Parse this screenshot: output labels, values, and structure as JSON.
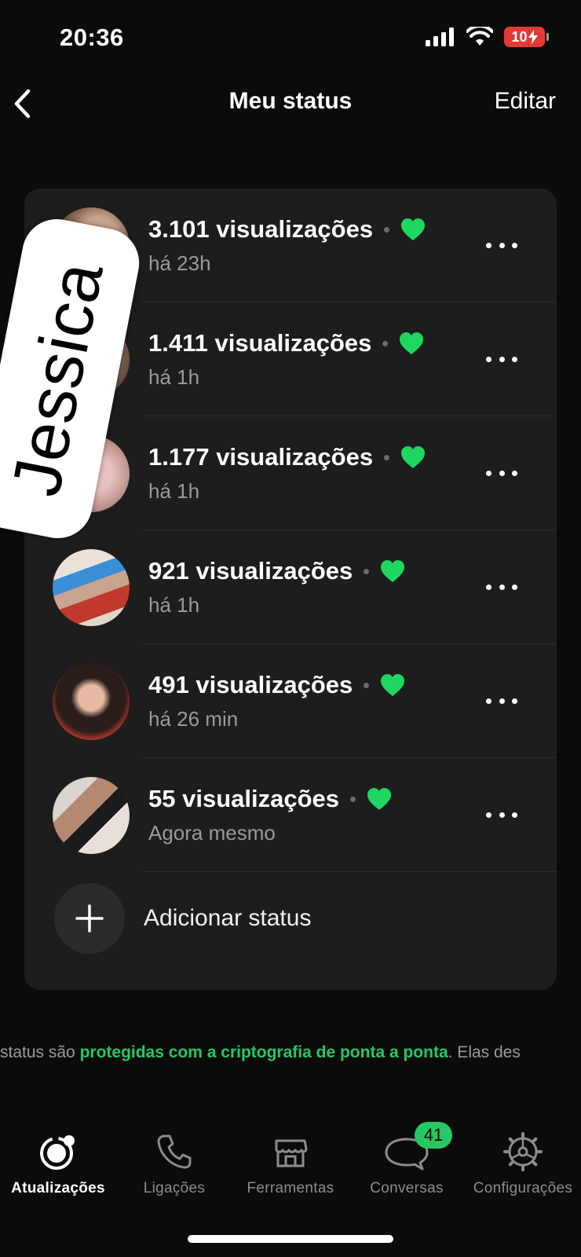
{
  "status_bar": {
    "time": "20:36",
    "battery": "10"
  },
  "nav": {
    "title": "Meu status",
    "edit_label": "Editar"
  },
  "sticker": {
    "text": "Jessica"
  },
  "statuses": [
    {
      "views": "3.101 visualizações",
      "time": "há 23h"
    },
    {
      "views": "1.411 visualizações",
      "time": "há 1h"
    },
    {
      "views": "1.177 visualizações",
      "time": "há 1h"
    },
    {
      "views": "921 visualizações",
      "time": "há 1h"
    },
    {
      "views": "491 visualizações",
      "time": "há 26 min"
    },
    {
      "views": "55 visualizações",
      "time": "Agora mesmo"
    }
  ],
  "add_status_label": "Adicionar status",
  "encryption_note": {
    "prefix": "status são ",
    "highlight": "protegidas com a criptografia de ponta a ponta",
    "suffix": ". Elas des"
  },
  "tabs": [
    {
      "label": "Atualizações",
      "icon": "updates-icon",
      "active": true
    },
    {
      "label": "Ligações",
      "icon": "phone-icon"
    },
    {
      "label": "Ferramentas",
      "icon": "store-icon"
    },
    {
      "label": "Conversas",
      "icon": "chat-icon",
      "badge": "41"
    },
    {
      "label": "Configurações",
      "icon": "gear-icon"
    }
  ],
  "colors": {
    "accent_green": "#25c862",
    "heart_green": "#1ed760",
    "battery_red": "#e53935"
  }
}
